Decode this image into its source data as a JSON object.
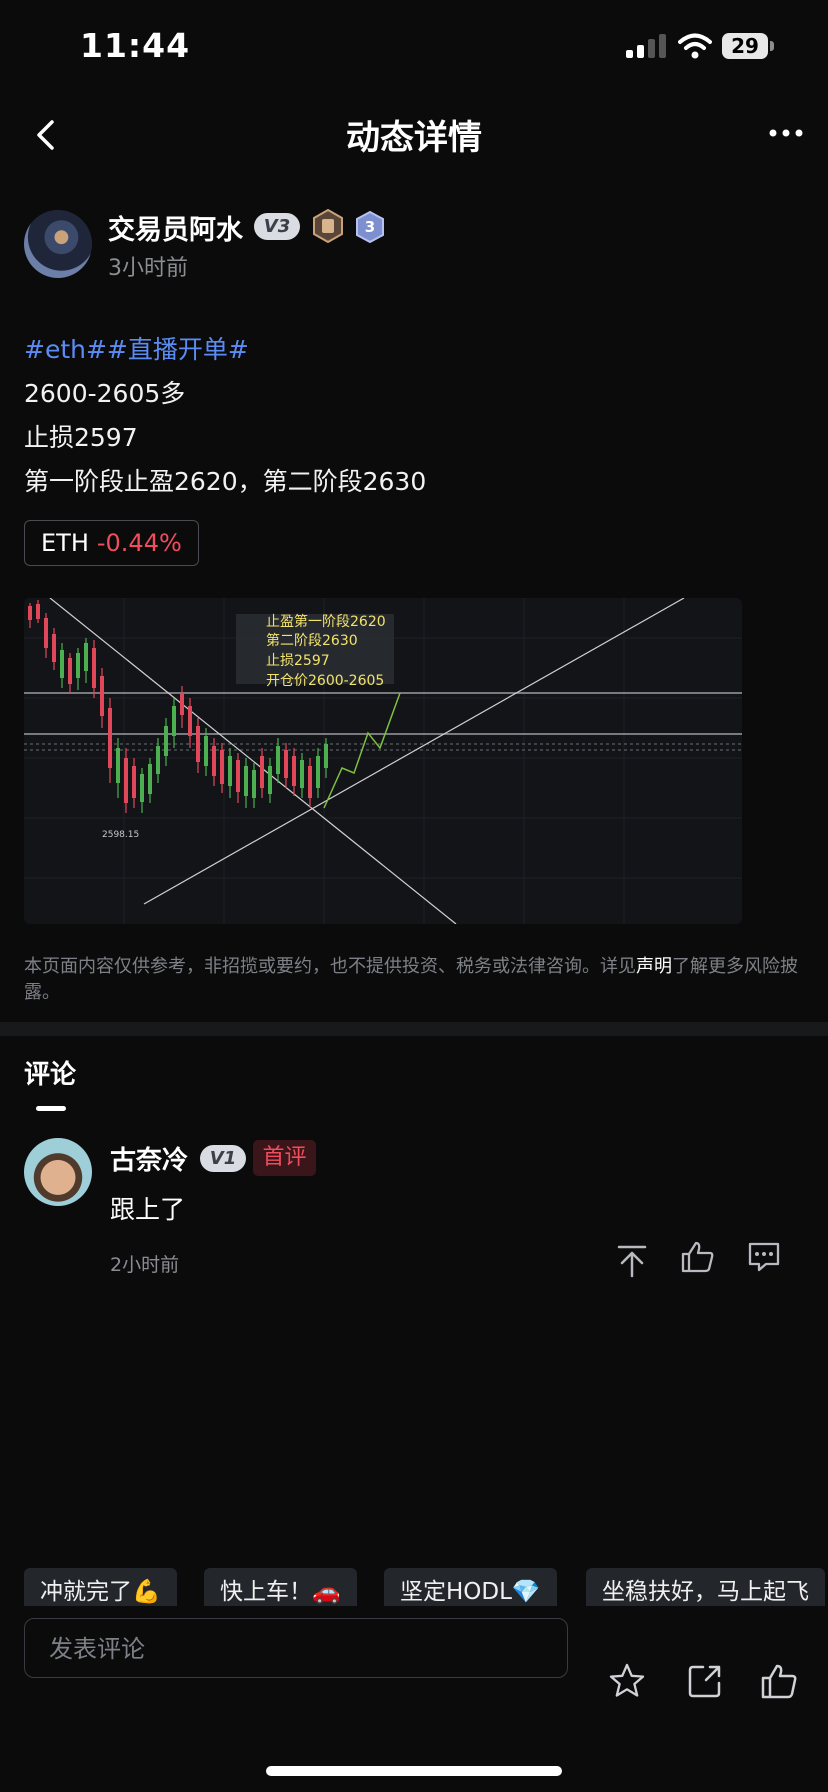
{
  "status_bar": {
    "time": "11:44",
    "battery": "29"
  },
  "header": {
    "title": "动态详情"
  },
  "post": {
    "author": "交易员阿水",
    "vip_level": "V3",
    "level_badge": "3",
    "time": "3小时前",
    "hashtags": "#eth##直播开单#",
    "lines": [
      "2600-2605多",
      "止损2597",
      "第一阶段止盈2620，第二阶段2630"
    ],
    "coin": {
      "symbol": "ETH",
      "change": "-0.44%"
    }
  },
  "chart": {
    "annotation_lines": [
      "止盈第一阶段2620",
      "第二阶段2630",
      "止损2597",
      "开仓价2600-2605"
    ],
    "low_marker": "2598.15"
  },
  "disclaimer": {
    "text_before": "本页面内容仅供参考，非招揽或要约，也不提供投资、税务或法律咨询。详见",
    "link": "声明",
    "text_after": "了解更多风险披露。"
  },
  "comments": {
    "title": "评论",
    "items": [
      {
        "user": "古奈冷",
        "vip_level": "V1",
        "tag": "首评",
        "text": "跟上了",
        "time": "2小时前"
      }
    ]
  },
  "quick_replies": [
    "冲就完了💪",
    "快上车！🚗",
    "坚定HODL💎",
    "坐稳扶好，马上起飞"
  ],
  "comment_input": {
    "placeholder": "发表评论"
  },
  "colors": {
    "background": "#0b0b0c",
    "accent_blue": "#5b8cf3",
    "down_red": "#f04d5d"
  }
}
